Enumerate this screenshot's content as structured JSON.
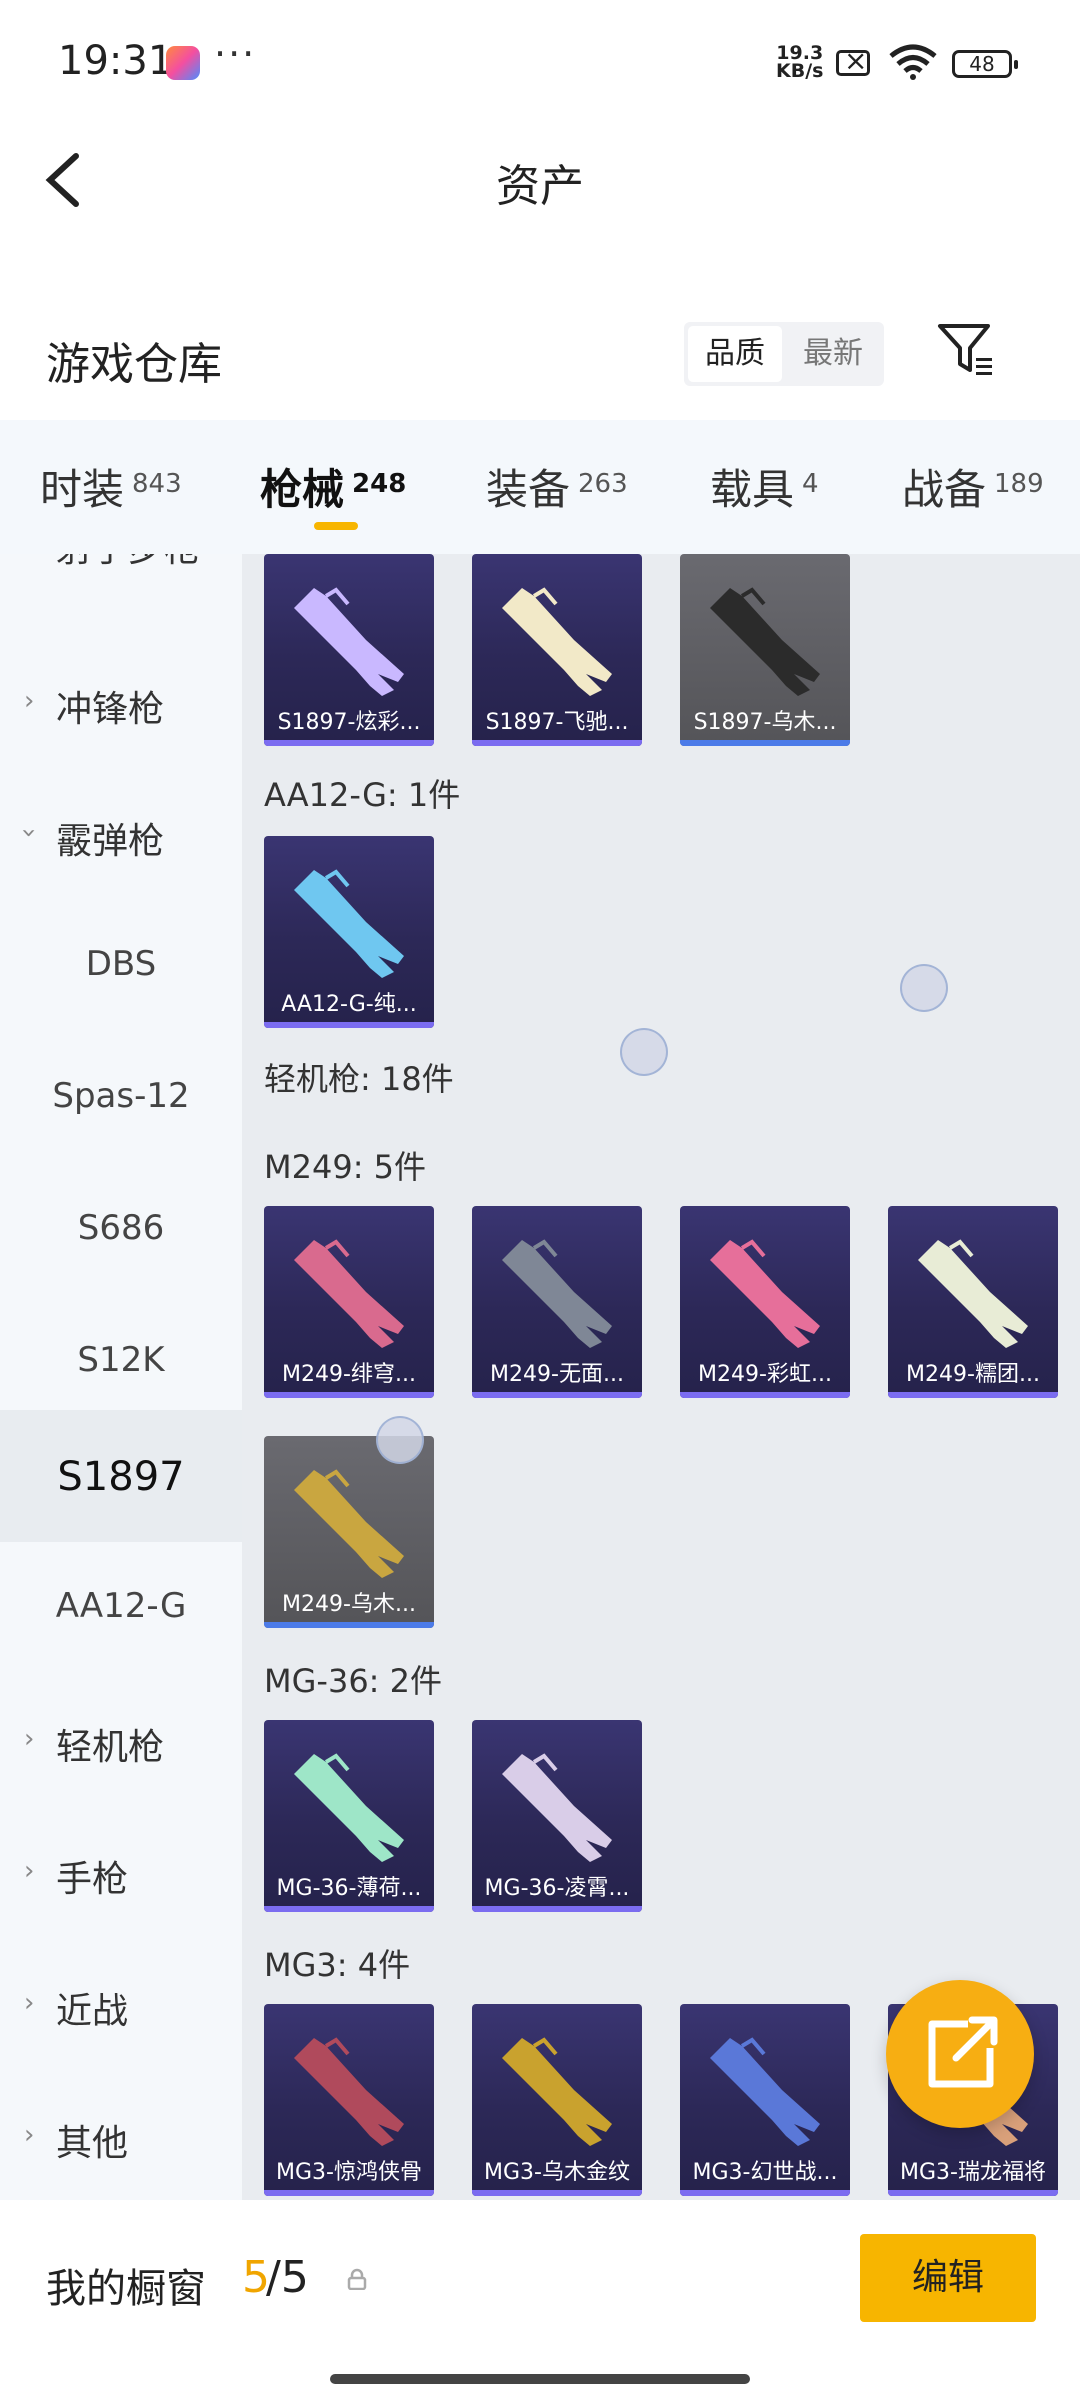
{
  "status": {
    "time": "19:31",
    "net_speed_value": "19.3",
    "net_speed_unit": "KB/s",
    "battery": "48"
  },
  "header": {
    "title": "资产"
  },
  "warehouse": {
    "title": "游戏仓库",
    "sort_options": [
      "品质",
      "最新"
    ],
    "selected_sort": "品质"
  },
  "tabs": [
    {
      "label": "时装",
      "count": "843"
    },
    {
      "label": "枪械",
      "count": "248",
      "active": true
    },
    {
      "label": "装备",
      "count": "263"
    },
    {
      "label": "载具",
      "count": "4"
    },
    {
      "label": "战备",
      "count": "189"
    }
  ],
  "sidebar": {
    "partial_top": "射手步枪",
    "items": [
      "冲锋枪",
      "霰弹枪",
      "DBS",
      "Spas-12",
      "S686",
      "S12K",
      "S1897",
      "AA12-G",
      "轻机枪",
      "手枪",
      "近战",
      "其他"
    ],
    "selected": "S1897"
  },
  "content": {
    "row_top_cards": [
      "S1897-炫彩...",
      "S1897-飞驰...",
      "S1897-乌木..."
    ],
    "aa12_header": "AA12-G: 1件",
    "aa12_cards": [
      "AA12-G-纯..."
    ],
    "lmg_header": "轻机枪: 18件",
    "m249_header": "M249: 5件",
    "m249_cards": [
      "M249-绯穹...",
      "M249-无面...",
      "M249-彩虹...",
      "M249-糯团...",
      "M249-乌木..."
    ],
    "mg36_header": "MG-36: 2件",
    "mg36_cards": [
      "MG-36-薄荷...",
      "MG-36-凌霄..."
    ],
    "mg3_header": "MG3: 4件",
    "mg3_cards": [
      "MG3-惊鸿侠骨",
      "MG3-乌木金纹",
      "MG3-幻世战...",
      "MG3-瑞龙福将"
    ]
  },
  "bottom": {
    "label": "我的橱窗",
    "count_current": "5",
    "count_sep": "/5",
    "edit_label": "编辑"
  },
  "colors": {
    "accent": "#f7b500",
    "card_bg": "#2c2857",
    "card_grey": "#5a5a5e",
    "sidebar_bg": "#f5f8fb"
  },
  "icons": [
    "back-arrow-icon",
    "filter-icon",
    "lock-icon",
    "share-icon",
    "wifi-icon",
    "battery-icon"
  ]
}
